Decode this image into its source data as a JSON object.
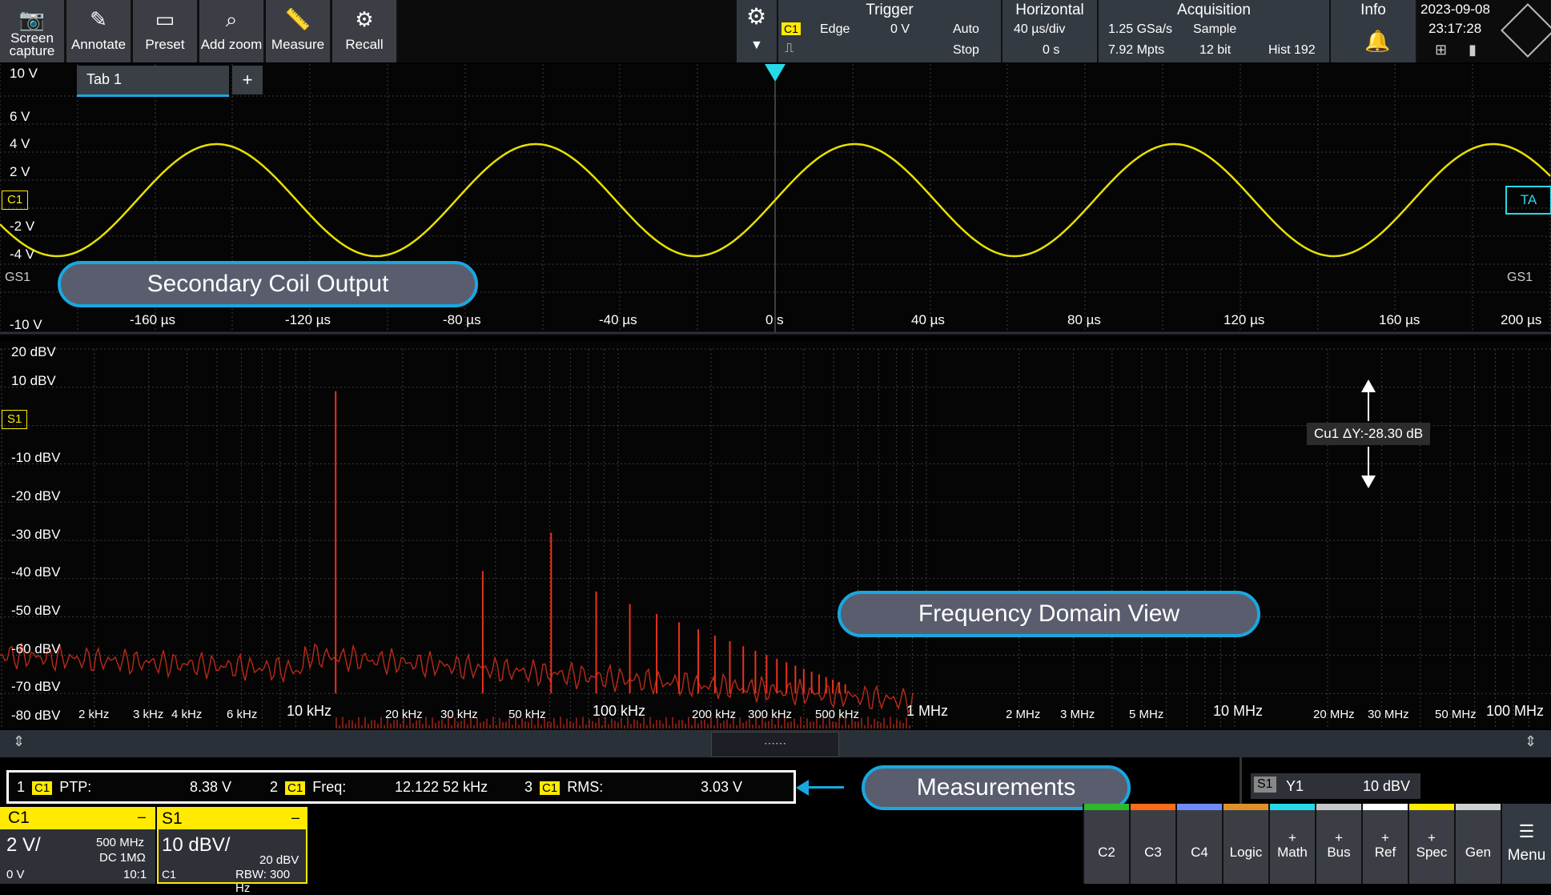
{
  "toolbar": {
    "buttons": [
      {
        "label": "Screen capture",
        "icon": "camera-icon"
      },
      {
        "label": "Annotate",
        "icon": "pencil-icon"
      },
      {
        "label": "Preset",
        "icon": "monitor-icon"
      },
      {
        "label": "Add zoom",
        "icon": "magnifier-icon"
      },
      {
        "label": "Measure",
        "icon": "ruler-icon"
      },
      {
        "label": "Recall",
        "icon": "gear-recall-icon"
      }
    ]
  },
  "trigger": {
    "title": "Trigger",
    "source": "C1",
    "type": "Edge",
    "level": "0 V",
    "mode": "Auto",
    "state": "Stop"
  },
  "horizontal": {
    "title": "Horizontal",
    "scale": "40 µs/div",
    "position": "0 s"
  },
  "acquisition": {
    "title": "Acquisition",
    "rate": "1.25 GSa/s",
    "points": "7.92 Mpts",
    "mode": "Sample",
    "bits": "12 bit",
    "hist": "Hist 192"
  },
  "info": {
    "title": "Info"
  },
  "clock": {
    "date": "2023-09-08",
    "time": "23:17:28"
  },
  "tab": {
    "label": "Tab 1",
    "add": "+"
  },
  "time_panel": {
    "y_labels": [
      "10 V",
      "6 V",
      "4 V",
      "2 V",
      "-2 V",
      "-4 V",
      "-10 V"
    ],
    "x_labels": [
      "-160 µs",
      "-120 µs",
      "-80 µs",
      "-40 µs",
      "0 s",
      "40 µs",
      "80 µs",
      "120 µs",
      "160 µs",
      "200 µs"
    ],
    "ch_marker": "C1",
    "ta_marker": "TA",
    "gs_left": "GS1",
    "gs_right": "GS1",
    "callout": "Secondary Coil Output"
  },
  "freq_panel": {
    "y_labels": [
      "20 dBV",
      "10 dBV",
      "-10 dBV",
      "-20 dBV",
      "-30 dBV",
      "-40 dBV",
      "-50 dBV",
      "-60 dBV",
      "-70 dBV",
      "-80 dBV"
    ],
    "s1_marker": "S1",
    "x_labels_small": [
      "2 kHz",
      "3 kHz",
      "4 kHz",
      "6 kHz",
      "20 kHz",
      "30 kHz",
      "50 kHz",
      "200 kHz",
      "300 kHz",
      "500 kHz",
      "2 MHz",
      "3 MHz",
      "5 MHz",
      "20 MHz",
      "30 MHz",
      "50 MHz"
    ],
    "x_labels_big": [
      "10 kHz",
      "100 kHz",
      "1 MHz",
      "10 MHz",
      "100 MHz"
    ],
    "cursor_label": "Cu1 ΔY:-28.30 dB",
    "callout": "Frequency Domain View"
  },
  "measurements": {
    "items": [
      {
        "num": "1",
        "src": "C1",
        "name": "PTP:",
        "value": "8.38 V"
      },
      {
        "num": "2",
        "src": "C1",
        "name": "Freq:",
        "value": "12.122 52 kHz"
      },
      {
        "num": "3",
        "src": "C1",
        "name": "RMS:",
        "value": "3.03 V"
      }
    ],
    "callout": "Measurements"
  },
  "s1_readout": {
    "tag": "S1",
    "name": "Y1",
    "value": "10 dBV"
  },
  "ch_c1": {
    "name": "C1",
    "scale": "2 V/",
    "bw": "500 MHz",
    "coupling": "DC 1MΩ",
    "offset": "0 V",
    "probe": "10:1",
    "minus": "–"
  },
  "ch_s1": {
    "name": "S1",
    "scale": "10 dBV/",
    "ref": "20 dBV",
    "src": "C1",
    "rbw": "RBW: 300 Hz",
    "minus": "–"
  },
  "bottom_buttons": [
    {
      "label": "C2",
      "color": "#2db82d"
    },
    {
      "label": "C3",
      "color": "#ff6a1a"
    },
    {
      "label": "C4",
      "color": "#6f8cff"
    },
    {
      "label": "Logic",
      "color": "#e0902a"
    },
    {
      "label": "+\nMath",
      "color": "#27d8e8"
    },
    {
      "label": "+\nBus",
      "color": "#c7c7c7"
    },
    {
      "label": "+\nRef",
      "color": "#ffffff"
    },
    {
      "label": "+\nSpec",
      "color": "#ffea00"
    },
    {
      "label": "Gen",
      "color": "#d0d0d0"
    },
    {
      "label": "Menu",
      "color": ""
    }
  ],
  "colors": {
    "trace": "#e8e000",
    "spectrum": "#e8321e",
    "accent": "#18a8e0"
  }
}
